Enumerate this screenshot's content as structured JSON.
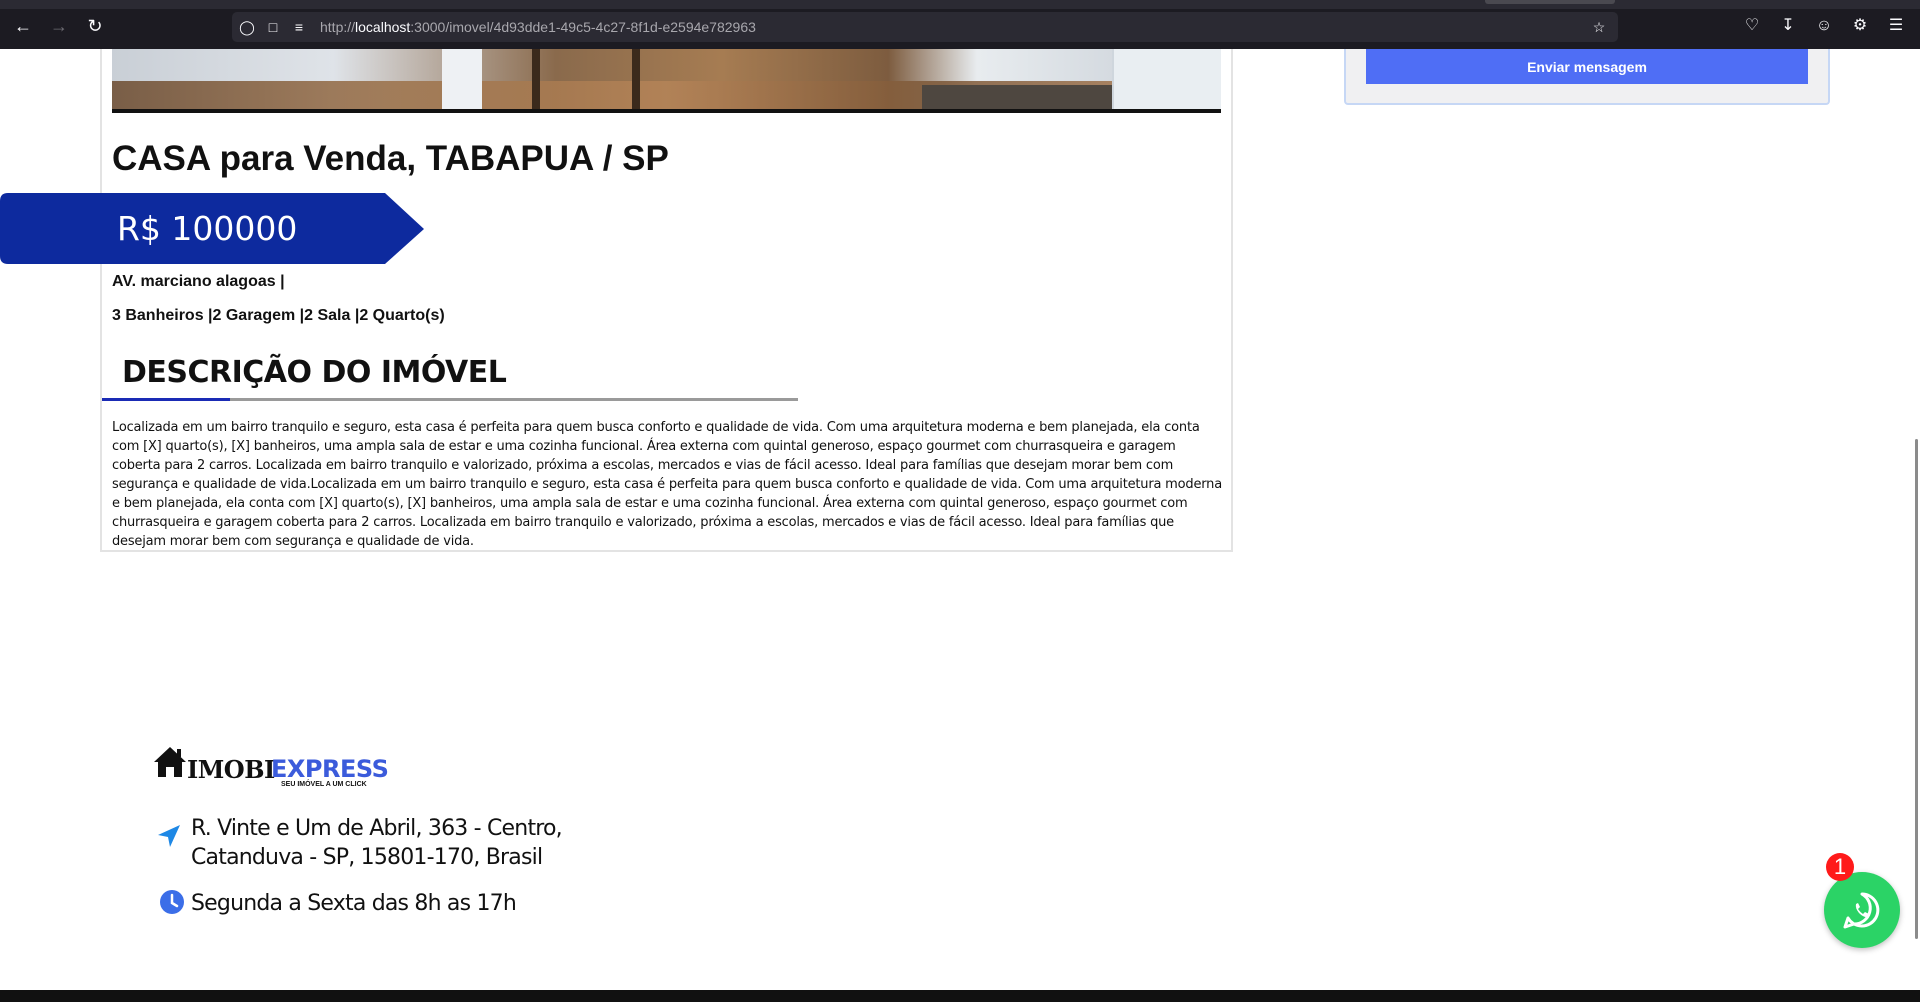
{
  "browser": {
    "url_prefix": "http://",
    "url_host": "localhost",
    "url_path": ":3000/imovel/4d93dde1-49c5-4c27-8f1d-e2594e782963"
  },
  "contact_form": {
    "send_label": "Enviar mensagem"
  },
  "listing": {
    "title": "CASA para Venda, TABAPUA / SP",
    "price": "R$ 100000",
    "address": "AV. marciano alagoas |",
    "features": "3 Banheiros |2 Garagem |2 Sala |2 Quarto(s)",
    "description_heading": "DESCRIÇÃO DO IMÓVEL",
    "description": "Localizada em um bairro tranquilo e seguro, esta casa é perfeita para quem busca conforto e qualidade de vida. Com uma arquitetura moderna e bem planejada, ela conta com [X] quarto(s), [X] banheiros, uma ampla sala de estar e uma cozinha funcional. Área externa com quintal generoso, espaço gourmet com churrasqueira e garagem coberta para 2 carros. Localizada em bairro tranquilo e valorizado, próxima a escolas, mercados e vias de fácil acesso. Ideal para famílias que desejam morar bem com segurança e qualidade de vida.Localizada em um bairro tranquilo e seguro, esta casa é perfeita para quem busca conforto e qualidade de vida. Com uma arquitetura moderna e bem planejada, ela conta com [X] quarto(s), [X] banheiros, uma ampla sala de estar e uma cozinha funcional. Área externa com quintal generoso, espaço gourmet com churrasqueira e garagem coberta para 2 carros. Localizada em bairro tranquilo e valorizado, próxima a escolas, mercados e vias de fácil acesso. Ideal para famílias que desejam morar bem com segurança e qualidade de vida."
  },
  "footer": {
    "logo_main": "IMOBI",
    "logo_accent": "EXPRESS",
    "logo_tagline": "SEU IMÓVEL A UM CLICK",
    "address_line1": "R. Vinte e Um de Abril, 363 - Centro,",
    "address_line2": "Catanduva - SP, 15801-170, Brasil",
    "hours": "Segunda a Sexta das 8h as 17h"
  },
  "whatsapp": {
    "badge_count": "1",
    "icon": "whatsapp-icon"
  },
  "colors": {
    "price_ribbon": "#0d2a9e",
    "accent_blue": "#4f6ef5",
    "whatsapp_green": "#2bd366",
    "badge_red": "#ff1a1a",
    "location_icon": "#1e88e5",
    "clock_icon": "#3b6ee8"
  }
}
